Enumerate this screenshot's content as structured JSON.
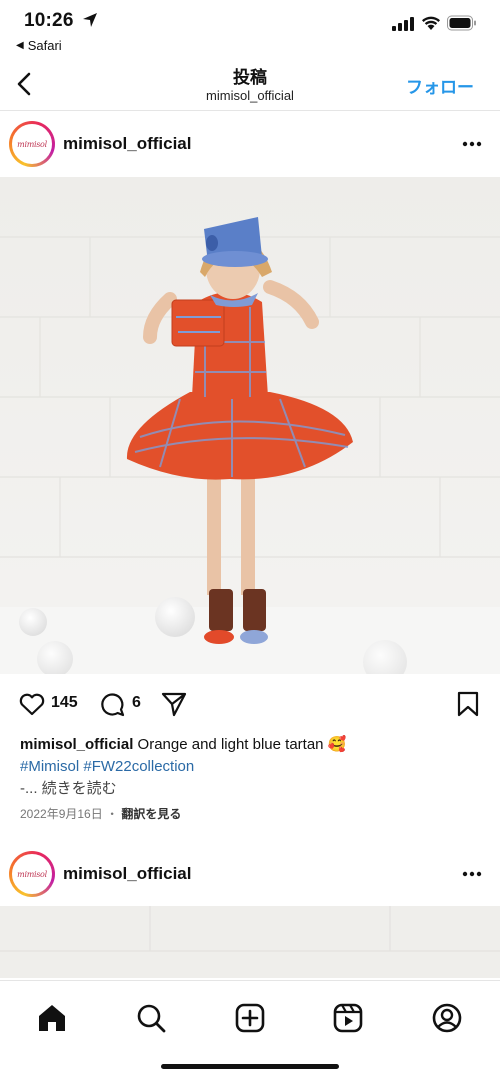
{
  "status_bar": {
    "time": "10:26",
    "back_app": "Safari"
  },
  "header": {
    "title": "投稿",
    "subtitle": "mimisol_official",
    "follow": "フォロー"
  },
  "post": {
    "username": "mimisol_official",
    "avatar_text": "mimisol",
    "likes": "145",
    "comments": "6",
    "caption_user": "mimisol_official",
    "caption_text": "Orange and light blue tartan 🥰",
    "hashtag1": "#Mimisol",
    "hashtag2": "#FW22collection",
    "caption_prefix": "-...",
    "read_more": "続きを読む",
    "date": "2022年9月16日",
    "date_sep": "・",
    "translate": "翻訳を見る"
  },
  "next_post": {
    "username": "mimisol_official",
    "avatar_text": "mimisol"
  },
  "tab_bar": {
    "items": [
      {
        "icon": "home-icon"
      },
      {
        "icon": "search-icon"
      },
      {
        "icon": "create-icon"
      },
      {
        "icon": "reels-icon"
      },
      {
        "icon": "profile-icon"
      }
    ]
  },
  "colors": {
    "accent": "#2596e8",
    "hashtag": "#2b6aa6",
    "dress": "#e2502b",
    "hat": "#5a7fc8"
  }
}
